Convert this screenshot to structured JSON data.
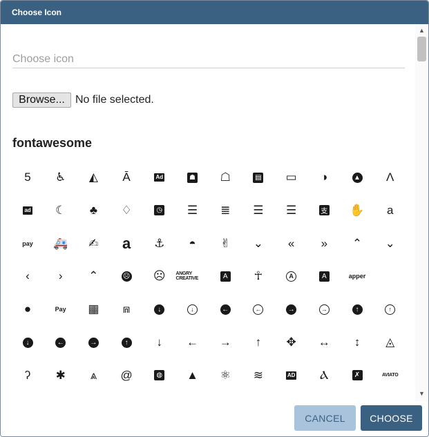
{
  "dialog": {
    "title": "Choose Icon"
  },
  "search": {
    "placeholder": "Choose icon",
    "value": ""
  },
  "file": {
    "browse_label": "Browse...",
    "status": "No file selected."
  },
  "section": {
    "title": "fontawesome"
  },
  "icons": {
    "rows": [
      [
        {
          "name": "500px-icon",
          "glyph": "5",
          "style": "plain"
        },
        {
          "name": "accessible-icon",
          "glyph": "♿",
          "style": "plain"
        },
        {
          "name": "accusoft-icon",
          "glyph": "◭",
          "style": "plain"
        },
        {
          "name": "acquisitions-incorporated-icon",
          "glyph": "Ā",
          "style": "plain"
        },
        {
          "name": "ad-icon",
          "glyph": "Ad",
          "style": "box"
        },
        {
          "name": "address-book-icon",
          "glyph": "☗",
          "style": "boxsq"
        },
        {
          "name": "address-book-outline-icon",
          "glyph": "☖",
          "style": "plain"
        },
        {
          "name": "address-card-icon",
          "glyph": "▤",
          "style": "boxsq"
        },
        {
          "name": "address-card-outline-icon",
          "glyph": "▭",
          "style": "plain"
        },
        {
          "name": "adjust-icon",
          "glyph": "◑",
          "style": "plain"
        },
        {
          "name": "adversal-icon",
          "glyph": "▲",
          "style": "circ"
        },
        {
          "name": "adobe-icon",
          "glyph": "Λ",
          "style": "plain"
        }
      ],
      [
        {
          "name": "adn-icon",
          "glyph": "ad",
          "style": "box"
        },
        {
          "name": "affiliatetheme-icon",
          "glyph": "☾",
          "style": "plain"
        },
        {
          "name": "air-freshener-icon",
          "glyph": "♣",
          "style": "plain"
        },
        {
          "name": "airbnb-icon",
          "glyph": "♢",
          "style": "plain"
        },
        {
          "name": "alarm-clock-icon",
          "glyph": "◷",
          "style": "boxsq"
        },
        {
          "name": "align-center-icon",
          "glyph": "☰",
          "style": "plain"
        },
        {
          "name": "align-justify-icon",
          "glyph": "≣",
          "style": "plain"
        },
        {
          "name": "align-left-icon",
          "glyph": "☰",
          "style": "plain"
        },
        {
          "name": "align-right-icon",
          "glyph": "☰",
          "style": "plain"
        },
        {
          "name": "alipay-icon",
          "glyph": "支",
          "style": "boxsq"
        },
        {
          "name": "allergies-icon",
          "glyph": "✋",
          "style": "plain"
        },
        {
          "name": "amazon-icon",
          "glyph": "a",
          "style": "plain"
        }
      ],
      [
        {
          "name": "amazon-pay-icon",
          "glyph": "pay",
          "style": "sm"
        },
        {
          "name": "ambulance-icon",
          "glyph": "🚑",
          "style": "plain"
        },
        {
          "name": "american-sign-language-icon",
          "glyph": "✍",
          "style": "plain"
        },
        {
          "name": "amilia-icon",
          "glyph": "a",
          "style": "plainbig"
        },
        {
          "name": "anchor-icon",
          "glyph": "⚓",
          "style": "plain"
        },
        {
          "name": "android-icon",
          "glyph": "◓",
          "style": "plain"
        },
        {
          "name": "angellist-icon",
          "glyph": "✌",
          "style": "plain"
        },
        {
          "name": "angle-double-down-icon",
          "glyph": "⌄",
          "style": "plain"
        },
        {
          "name": "angle-double-left-icon",
          "glyph": "«",
          "style": "plain"
        },
        {
          "name": "angle-double-right-icon",
          "glyph": "»",
          "style": "plain"
        },
        {
          "name": "angle-double-up-icon",
          "glyph": "⌃",
          "style": "plain"
        },
        {
          "name": "angle-down-icon",
          "glyph": "⌄",
          "style": "plain"
        }
      ],
      [
        {
          "name": "angle-left-icon",
          "glyph": "‹",
          "style": "plain"
        },
        {
          "name": "angle-right-icon",
          "glyph": "›",
          "style": "plain"
        },
        {
          "name": "angle-up-icon",
          "glyph": "⌃",
          "style": "plain"
        },
        {
          "name": "angry-icon",
          "glyph": "☹",
          "style": "circ"
        },
        {
          "name": "angry-outline-icon",
          "glyph": "☹",
          "style": "plain"
        },
        {
          "name": "angrycreative-icon",
          "glyph": "ANGRY CREATIVE",
          "style": "xs"
        },
        {
          "name": "angular-icon",
          "glyph": "A",
          "style": "boxsq"
        },
        {
          "name": "ankh-icon",
          "glyph": "☥",
          "style": "plain"
        },
        {
          "name": "app-store-icon",
          "glyph": "A",
          "style": "circo"
        },
        {
          "name": "app-store-ios-icon",
          "glyph": "A",
          "style": "boxsq"
        },
        {
          "name": "apper-icon",
          "glyph": "apper",
          "style": "sm"
        },
        {
          "name": "apple-icon",
          "glyph": "",
          "style": "plain"
        }
      ],
      [
        {
          "name": "apple-alt-icon",
          "glyph": "●",
          "style": "plain"
        },
        {
          "name": "apple-pay-icon",
          "glyph": "Pay",
          "style": "sm"
        },
        {
          "name": "archive-icon",
          "glyph": "▦",
          "style": "plain"
        },
        {
          "name": "archway-icon",
          "glyph": "⩎",
          "style": "plain"
        },
        {
          "name": "arrow-alt-circle-down-icon",
          "glyph": "↓",
          "style": "circ"
        },
        {
          "name": "arrow-alt-circle-down-outline-icon",
          "glyph": "↓",
          "style": "circo"
        },
        {
          "name": "arrow-alt-circle-left-icon",
          "glyph": "←",
          "style": "circ"
        },
        {
          "name": "arrow-alt-circle-left-outline-icon",
          "glyph": "←",
          "style": "circo"
        },
        {
          "name": "arrow-alt-circle-right-icon",
          "glyph": "→",
          "style": "circ"
        },
        {
          "name": "arrow-alt-circle-right-outline-icon",
          "glyph": "→",
          "style": "circo"
        },
        {
          "name": "arrow-alt-circle-up-icon",
          "glyph": "↑",
          "style": "circ"
        },
        {
          "name": "arrow-alt-circle-up-outline-icon",
          "glyph": "↑",
          "style": "circo"
        }
      ],
      [
        {
          "name": "arrow-circle-down-icon",
          "glyph": "↓",
          "style": "circ"
        },
        {
          "name": "arrow-circle-left-icon",
          "glyph": "←",
          "style": "circ"
        },
        {
          "name": "arrow-circle-right-icon",
          "glyph": "→",
          "style": "circ"
        },
        {
          "name": "arrow-circle-up-icon",
          "glyph": "↑",
          "style": "circ"
        },
        {
          "name": "arrow-down-icon",
          "glyph": "↓",
          "style": "plain"
        },
        {
          "name": "arrow-left-icon",
          "glyph": "←",
          "style": "plain"
        },
        {
          "name": "arrow-right-icon",
          "glyph": "→",
          "style": "plain"
        },
        {
          "name": "arrow-up-icon",
          "glyph": "↑",
          "style": "plain"
        },
        {
          "name": "arrows-alt-icon",
          "glyph": "✥",
          "style": "plain"
        },
        {
          "name": "arrows-alt-h-icon",
          "glyph": "↔",
          "style": "plain"
        },
        {
          "name": "arrows-alt-v-icon",
          "glyph": "↕",
          "style": "plain"
        },
        {
          "name": "artstation-icon",
          "glyph": "◬",
          "style": "plain"
        }
      ],
      [
        {
          "name": "assistive-listening-systems-icon",
          "glyph": "ʔ",
          "style": "plain"
        },
        {
          "name": "asterisk-icon",
          "glyph": "✱",
          "style": "plain"
        },
        {
          "name": "asymmetrik-icon",
          "glyph": "⩓",
          "style": "plain"
        },
        {
          "name": "at-icon",
          "glyph": "@",
          "style": "plain"
        },
        {
          "name": "atlas-icon",
          "glyph": "◍",
          "style": "boxsq"
        },
        {
          "name": "atlassian-icon",
          "glyph": "▲",
          "style": "plain"
        },
        {
          "name": "atom-icon",
          "glyph": "⚛",
          "style": "plain"
        },
        {
          "name": "audible-icon",
          "glyph": "≋",
          "style": "plain"
        },
        {
          "name": "audio-description-icon",
          "glyph": "AD",
          "style": "box"
        },
        {
          "name": "autoprefixer-icon",
          "glyph": "Ⲁ",
          "style": "plain"
        },
        {
          "name": "avianex-icon",
          "glyph": "✗",
          "style": "boxsq"
        },
        {
          "name": "aviato-icon",
          "glyph": "AVIATO",
          "style": "xs"
        }
      ]
    ]
  },
  "footer": {
    "cancel_label": "CANCEL",
    "choose_label": "CHOOSE"
  }
}
